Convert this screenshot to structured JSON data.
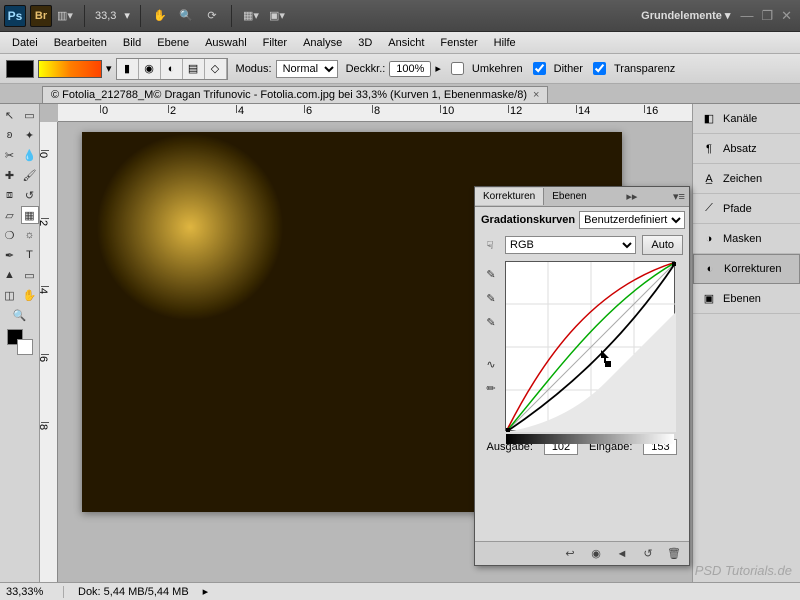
{
  "appbar": {
    "zoom": "33,3",
    "workspace": "Grundelemente ▾"
  },
  "menu": [
    "Datei",
    "Bearbeiten",
    "Bild",
    "Ebene",
    "Auswahl",
    "Filter",
    "Analyse",
    "3D",
    "Ansicht",
    "Fenster",
    "Hilfe"
  ],
  "optbar": {
    "mode_label": "Modus:",
    "mode_value": "Normal",
    "opacity_label": "Deckkr.:",
    "opacity_value": "100%",
    "chk_umkehren": "Umkehren",
    "chk_dither": "Dither",
    "chk_transparenz": "Transparenz"
  },
  "tab": {
    "title": "© Fotolia_212788_M© Dragan Trifunovic - Fotolia.com.jpg bei 33,3% (Kurven 1, Ebenenmaske/8)"
  },
  "dock": [
    "Kanäle",
    "Absatz",
    "Zeichen",
    "Pfade",
    "Masken",
    "Korrekturen",
    "Ebenen"
  ],
  "curves": {
    "tab1": "Korrekturen",
    "tab2": "Ebenen",
    "title": "Gradationskurven",
    "preset": "Benutzerdefiniert",
    "channel": "RGB",
    "auto": "Auto",
    "out_label": "Ausgabe:",
    "out_value": "102",
    "in_label": "Eingabe:",
    "in_value": "153"
  },
  "status": {
    "zoom": "33,33%",
    "doc": "Dok: 5,44 MB/5,44 MB"
  },
  "ruler_h": [
    "0",
    "2",
    "4",
    "6",
    "8",
    "10",
    "12",
    "14",
    "16"
  ],
  "ruler_v": [
    "0",
    "2",
    "4",
    "6",
    "8"
  ],
  "watermark": "PSD Tutorials.de",
  "chart_data": {
    "type": "line",
    "title": "Gradationskurven",
    "xlabel": "Eingabe",
    "ylabel": "Ausgabe",
    "xlim": [
      0,
      255
    ],
    "ylim": [
      0,
      255
    ],
    "series": [
      {
        "name": "RGB (Komposit)",
        "color": "#000000",
        "points": [
          [
            0,
            0
          ],
          [
            153,
            102
          ],
          [
            255,
            255
          ]
        ]
      },
      {
        "name": "Rot",
        "color": "#cc0000",
        "points": [
          [
            0,
            0
          ],
          [
            64,
            120
          ],
          [
            128,
            200
          ],
          [
            192,
            240
          ],
          [
            255,
            255
          ]
        ]
      },
      {
        "name": "Grün",
        "color": "#00aa00",
        "points": [
          [
            0,
            0
          ],
          [
            64,
            100
          ],
          [
            128,
            180
          ],
          [
            192,
            225
          ],
          [
            255,
            255
          ]
        ]
      },
      {
        "name": "Baseline",
        "color": "#888888",
        "points": [
          [
            0,
            0
          ],
          [
            255,
            255
          ]
        ]
      }
    ],
    "selected_point": {
      "input": 153,
      "output": 102
    }
  }
}
